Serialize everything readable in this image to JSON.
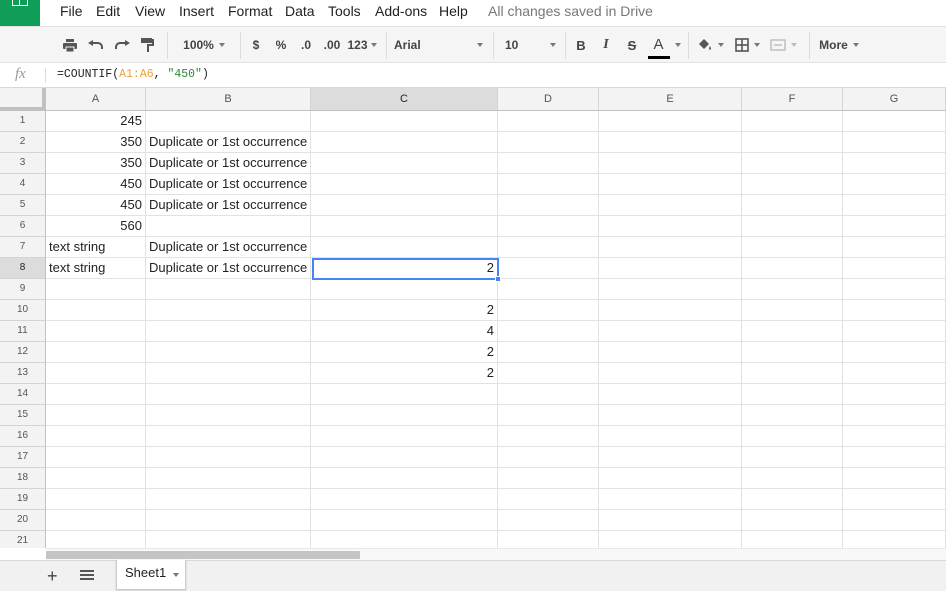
{
  "menu": {
    "items": [
      "File",
      "Edit",
      "View",
      "Insert",
      "Format",
      "Data",
      "Tools",
      "Add-ons",
      "Help"
    ],
    "save_status": "All changes saved in Drive"
  },
  "toolbar": {
    "zoom": "100%",
    "currency": "$",
    "percent": "%",
    "decimal_decrease": ".0",
    "decimal_increase": ".00",
    "number_format": "123",
    "font": "Arial",
    "font_size": "10",
    "bold": "B",
    "italic": "I",
    "strikethrough": "S",
    "text_color": "A",
    "more": "More",
    "text_color_value": "#000000"
  },
  "formula_bar": {
    "fx": "fx",
    "formula_prefix": "=COUNTIF(",
    "formula_range": "A1:A6",
    "formula_sep": ", ",
    "formula_criterion": "\"450\"",
    "formula_suffix": ")"
  },
  "columns": [
    "A",
    "B",
    "C",
    "D",
    "E",
    "F",
    "G"
  ],
  "selected_column": "C",
  "selected_row": "8",
  "rows": [
    "1",
    "2",
    "3",
    "4",
    "5",
    "6",
    "7",
    "8",
    "9",
    "10",
    "11",
    "12",
    "13",
    "14",
    "15",
    "16",
    "17",
    "18",
    "19",
    "20",
    "21"
  ],
  "cells": {
    "A1": "245",
    "A2": "350",
    "A3": "350",
    "A4": "450",
    "A5": "450",
    "A6": "560",
    "A7": "text string",
    "A8": "text string",
    "B2": "Duplicate or 1st occurrence",
    "B3": "Duplicate or 1st occurrence",
    "B4": "Duplicate or 1st occurrence",
    "B5": "Duplicate or 1st occurrence",
    "B7": "Duplicate or 1st occurrence",
    "B8": "Duplicate or 1st occurrence",
    "C8": "2",
    "C10": "2",
    "C11": "4",
    "C12": "2",
    "C13": "2"
  },
  "sheet_tabs": [
    {
      "label": "Sheet1"
    }
  ],
  "colors": {
    "brand_green": "#0f9d58",
    "selection_blue": "#4285f4",
    "formula_range": "#e8a33c",
    "formula_string": "#2a8a3a"
  }
}
